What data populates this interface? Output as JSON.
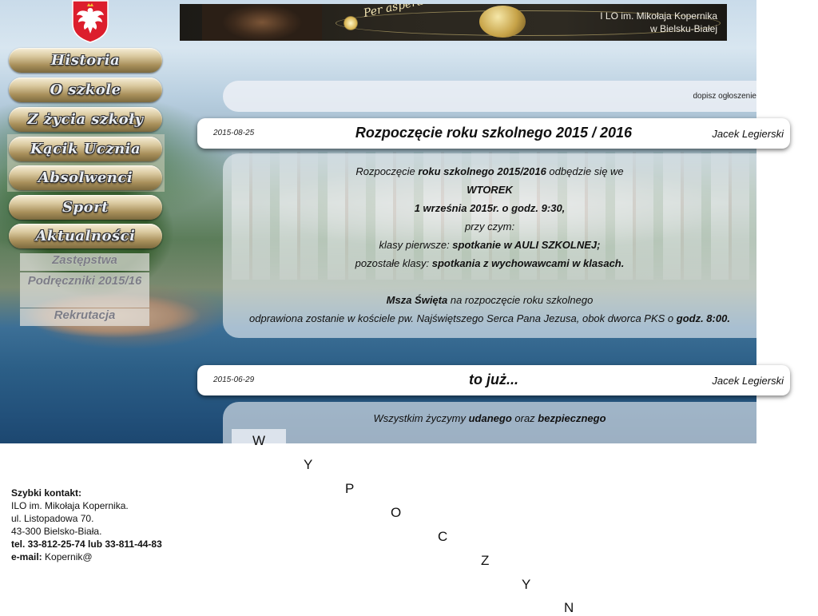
{
  "banner": {
    "motto": "Per aspera ad Astra",
    "school_line1": "I LO im. Mikołaja Kopernika",
    "school_line2": "w Bielsku-Białej"
  },
  "menu": {
    "items": [
      {
        "label": "Historia"
      },
      {
        "label": "O szkole"
      },
      {
        "label": "Z życia szkoły"
      },
      {
        "label": "Kącik Ucznia"
      },
      {
        "label": "Absolwenci"
      },
      {
        "label": "Sport"
      },
      {
        "label": "Aktualności"
      }
    ],
    "submenu": [
      {
        "label": "Zastępstwa"
      },
      {
        "label": "Podręczniki 2015/16"
      },
      {
        "label": "Rekrutacja"
      }
    ]
  },
  "notice": {
    "add_link": "dopisz ogłoszenie"
  },
  "posts": [
    {
      "date": "2015-08-25",
      "title": "Rozpoczęcie roku szkolnego 2015 / 2016",
      "author": "Jacek Legierski",
      "l1a": "Rozpoczęcie ",
      "l1b": "roku szkolnego 2015/2016",
      "l1c": " odbędzie się we",
      "l2": "WTOREK",
      "l3": "1 września 2015r. o godz. 9:30,",
      "l4": "przy czym:",
      "l5a": "klasy pierwsze: ",
      "l5b": "spotkanie w AULI SZKOLNEJ;",
      "l6a": "pozostałe klasy: ",
      "l6b": "spotkania z wychowawcami w klasach.",
      "l7a": "Msza Święta",
      "l7b": " na rozpoczęcie roku szkolnego",
      "l8a": "odprawiona zostanie w kościele pw. Najświętszego Serca Pana Jezusa, obok dworca PKS o ",
      "l8b": "godz. 8:00."
    },
    {
      "date": "2015-06-29",
      "title": "to już...",
      "author": "Jacek Legierski",
      "l1a": "Wszystkim życzymy ",
      "l1b": "udanego",
      "l1c": " oraz ",
      "l1d": "bezpiecznego"
    }
  ],
  "letters": [
    "W",
    "Y",
    "P",
    "O",
    "C",
    "Z",
    "Y",
    "N"
  ],
  "contact": {
    "heading": "Szybki kontakt:",
    "name": "ILO im. Mikołaja Kopernika.",
    "street": "ul. Listopadowa 70.",
    "city": "43-300 Bielsko-Biała.",
    "phone": "tel. 33-812-25-74 lub 33-811-44-83",
    "email_label": "e-mail:",
    "email_value": " Kopernik@"
  },
  "colors": {
    "menu_gold": "#c9b27a",
    "menu_text": "#e9edf1",
    "submenu_text": "#7c7c86",
    "banner_bg": "#2b271f",
    "emblem_red": "#dc1e2d"
  }
}
